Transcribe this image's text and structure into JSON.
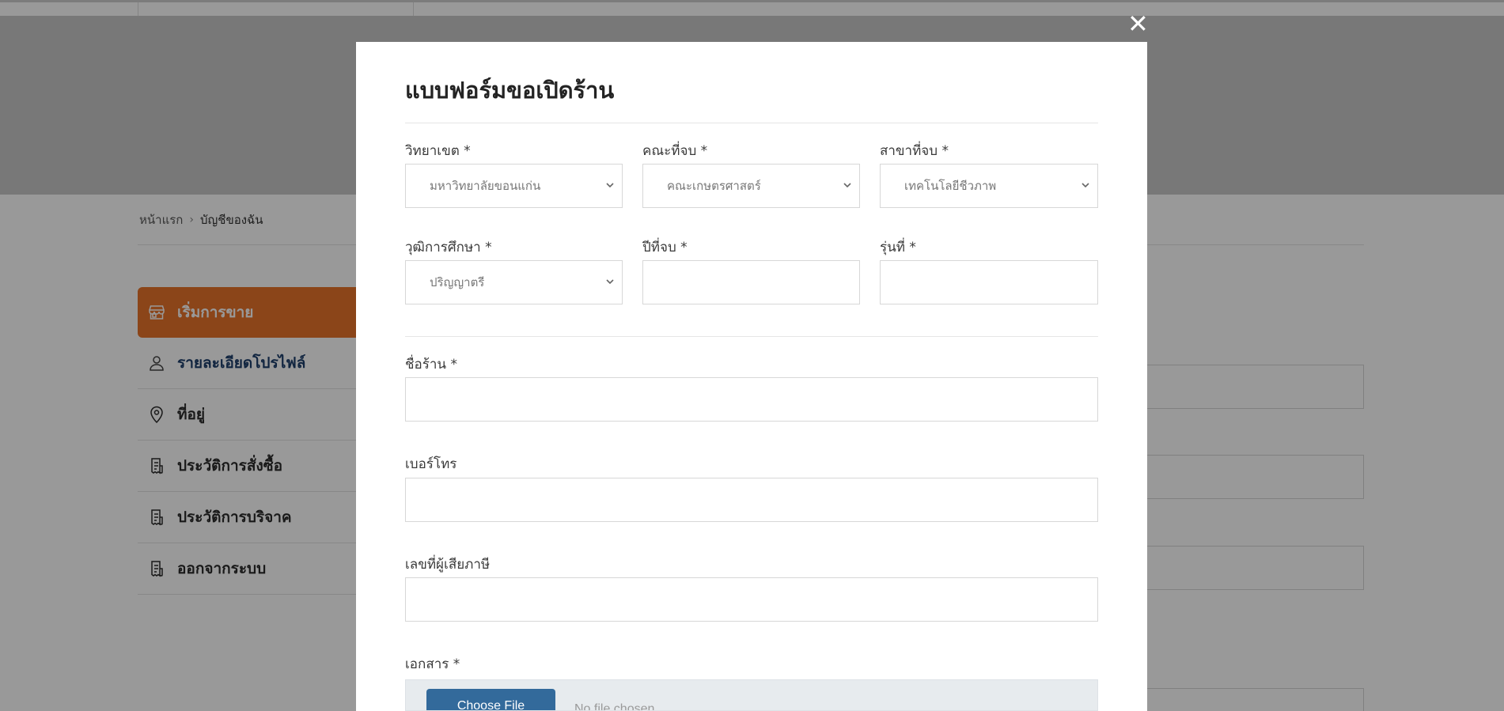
{
  "breadcrumb": {
    "home": "หน้าแรก",
    "current": "บัญชีของฉัน"
  },
  "sidebar": {
    "items": [
      {
        "label": "เริ่มการขาย",
        "icon": "store-icon",
        "active": true
      },
      {
        "label": "รายละเอียดโปรไฟล์",
        "icon": "user-icon",
        "active": false
      },
      {
        "label": "ที่อยู่",
        "icon": "map-pin-icon",
        "active": false
      },
      {
        "label": "ประวัติการสั่งซื้อ",
        "icon": "receipt-icon",
        "active": false
      },
      {
        "label": "ประวัติการบริจาค",
        "icon": "receipt-icon",
        "active": false
      },
      {
        "label": "ออกจากระบบ",
        "icon": "receipt-icon",
        "active": false
      }
    ]
  },
  "modal": {
    "title": "แบบฟอร์มขอเปิดร้าน",
    "close_label": "✕",
    "fields": {
      "campus": {
        "label": "วิทยาเขต *",
        "value": "มหาวิทยาลัยขอนแก่น"
      },
      "faculty": {
        "label": "คณะที่จบ *",
        "value": "คณะเกษตรศาสตร์"
      },
      "major": {
        "label": "สาขาที่จบ *",
        "value": "เทคโนโลยีชีวภาพ"
      },
      "degree": {
        "label": "วุฒิการศึกษา *",
        "value": "ปริญญาตรี"
      },
      "grad_year": {
        "label": "ปีที่จบ *",
        "value": ""
      },
      "generation": {
        "label": "รุ่นที่ *",
        "value": ""
      },
      "shop_name": {
        "label": "ชื่อร้าน *",
        "value": ""
      },
      "phone": {
        "label": "เบอร์โทร",
        "value": ""
      },
      "tax_id": {
        "label": "เลขที่ผู้เสียภาษี",
        "value": ""
      },
      "document": {
        "label": "เอกสาร *",
        "button": "Choose File",
        "status": "No file chosen"
      }
    }
  },
  "colors": {
    "accent": "#e8732a",
    "link": "#1d3e6c",
    "file_button": "#336a9b",
    "overlay": "rgba(0,0,0,0.40)"
  }
}
